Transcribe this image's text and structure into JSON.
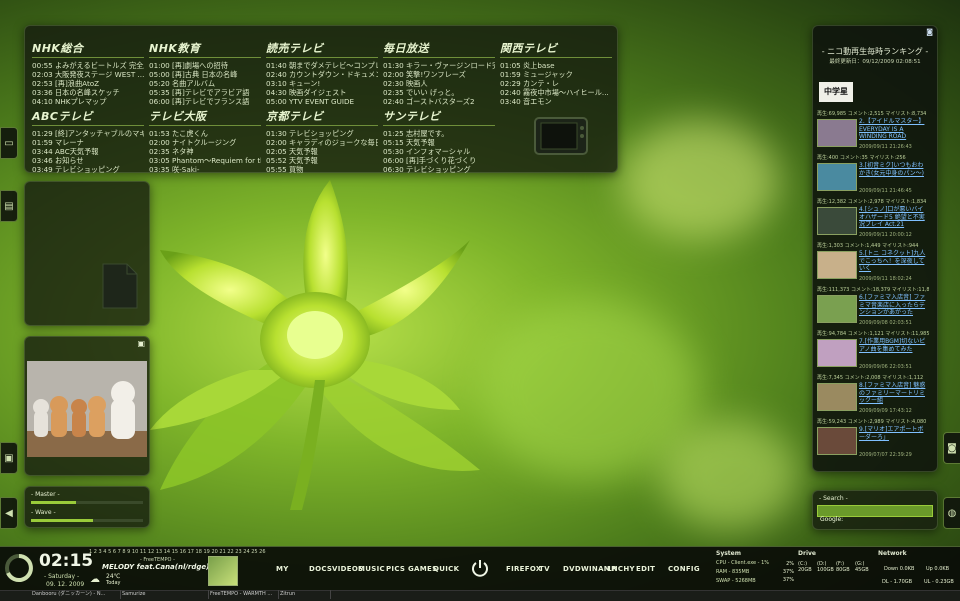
{
  "tv_guide": {
    "channels": [
      {
        "name": "NHK総合",
        "rows": [
          "00:55 よみがえるビートルズ 完全版",
          "02:03 大阪発夜ステージ WEST ...",
          "02:53 [再]浪曲AtoZ",
          "03:36 日本の名峰スケッチ",
          "04:10 NHKプレマップ"
        ]
      },
      {
        "name": "NHK教育",
        "rows": [
          "01:00 [再]劇場への招待",
          "05:00 [再]古典 日本の名峰",
          "05:20 名曲アルバム",
          "05:35 [再]テレビでアラビア語",
          "06:00 [再]テレビでフランス語"
        ]
      },
      {
        "name": "読売テレビ",
        "rows": [
          "01:40 朝までダメテレビ～コンプレッ...",
          "02:40 カウントダウン・ドキュメント ...",
          "03:10 キューン!",
          "04:30 映画ダイジェスト",
          "05:00 YTV EVENT GUIDE"
        ]
      },
      {
        "name": "毎日放送",
        "rows": [
          "01:30 キラー・ヴァージンロード完全...",
          "02:00 笑撃!ワンフレーズ",
          "02:30 映画人",
          "02:35 でいい げっと。",
          "02:40 ゴーストバスターズ2"
        ]
      },
      {
        "name": "関西テレビ",
        "rows": [
          "01:05 炎上base",
          "01:59 ミュージャック",
          "02:29 カンテ・レ",
          "02:40 霧夜中市場～ハイヒール...",
          "03:40 音エモン"
        ]
      },
      {
        "name": "ABCテレビ",
        "rows": [
          "01:29 [終]アンタッチャブルのマキマ...",
          "01:59 マレーナ",
          "03:44 ABC天気予報",
          "03:46 お知らせ",
          "03:49 テレビショッピング"
        ]
      },
      {
        "name": "テレビ大阪",
        "rows": [
          "01:53 たこ虎くん",
          "02:00 ナイトクルージング",
          "02:35 ネタ神",
          "03:05 Phantom～Requiem for the ...",
          "03:35 咲-Saki-"
        ]
      },
      {
        "name": "京都テレビ",
        "rows": [
          "01:30 テレビショッピング",
          "02:00 キャラディのジョークな毎日",
          "02:05 天気予報",
          "05:52 天気予報",
          "05:55 買物"
        ]
      },
      {
        "name": "サンテレビ",
        "rows": [
          "01:25 志村屋です。",
          "05:15 天気予報",
          "05:30 インフォマーシャル",
          "06:00 [再]手づくり花づくり",
          "06:30 テレビショッピング"
        ]
      }
    ]
  },
  "ranking": {
    "title": "- ニコ動再生毎時ランキング -",
    "updated": "最終更新日：09/12/2009 02:08:51",
    "top_banner": "中学星",
    "items": [
      {
        "meta": "再生:69,985 コメント:2,515 マイリスト:8,734",
        "title": "2.【アイドルマスター】EVERYDAY IS A WINDING ROAD",
        "date": "2009/09/11 21:26:43",
        "thumb": "#8a7a90"
      },
      {
        "meta": "再生:400 コメント:35 マイリスト:256",
        "title": "3.[初音ミク]いつもおわかき(女元中身のパン～)",
        "date": "2009/09/11 21:46:45",
        "thumb": "#4a8aa0"
      },
      {
        "meta": "再生:12,382 コメント:2,978 マイリスト:1,834",
        "title": "4.[シュノ]口が悪いバイオハザード5 絶望と不実況プレイ Act.21",
        "date": "2009/09/11 20:00:12",
        "thumb": "#3a4a3a"
      },
      {
        "meta": "再生:1,303 コメント:1,449 マイリスト:944",
        "title": "5.[トニ コネクット]九人でこっちへ！を深夜していく",
        "date": "2009/09/11 18:02:24",
        "thumb": "#c8b08a"
      },
      {
        "meta": "再生:111,373 コメント:18,379 マイリスト:11,815",
        "title": "6.[ファミマ入店音] ファミマ音楽店に入ったらテンションがあがった",
        "date": "2009/09/08 02:03:51",
        "thumb": "#7aa050"
      },
      {
        "meta": "再生:94,784 コメント:1,121 マイリスト:11,985",
        "title": "7.[作業用BGM]切ないピアノ曲を集めてみた",
        "date": "2009/09/06 22:03:51",
        "thumb": "#c0a0c0"
      },
      {
        "meta": "再生:7,345 コメント:2,008 マイリスト:1,112",
        "title": "8.[ファミマ入店音] 魅惑のファミリーマートリミックー組",
        "date": "2009/09/09 17:43:12",
        "thumb": "#9a8a60"
      },
      {
        "meta": "再生:59,243 コメント:2,989 マイリスト:4,080",
        "title": "9.[マリオ]エアポートボーダーろ」",
        "date": "2009/07/07 22:39:29",
        "thumb": "#6a4a3a"
      }
    ]
  },
  "search": {
    "label": "- Search -",
    "engine": "Google:"
  },
  "volume": {
    "master_label": "- Master -",
    "wave_label": "- Wave -",
    "master_level": 0.4,
    "wave_level": 0.55
  },
  "clock": {
    "time": "02:15",
    "day": "- Saturday -",
    "date": "09. 12. 2009",
    "calendar": "1 2 3 4 5 6 7 8 9 10 11 12 13 14 15 16 17 18 19 20 21 22 23 24 25 26"
  },
  "weather": {
    "temp": "24℃",
    "today": "Today"
  },
  "music": {
    "source": "- FreeTEMPO -",
    "track": "MELODY feat.Cana(nl/rdge)"
  },
  "menu": [
    "MY",
    "DOCS",
    "VIDEOS",
    "MUSIC",
    "PICS",
    "GAMES",
    "QUICK",
    "FIREFOX",
    "TV",
    "DVD",
    "WINAMP",
    "LNCHY",
    "EDIT",
    "CONFIG"
  ],
  "system": {
    "title": "System",
    "cpu": "CPU - Client.exe - 1%",
    "ram": "RAM - 835MB",
    "swap": "SWAP - 5268MB",
    "cpu_pct": "2%",
    "ram_pct": "37%",
    "swap_pct": "37%",
    "cpu_level": 0.02,
    "ram_level": 0.37,
    "swap_level": 0.37
  },
  "drive": {
    "title": "Drive",
    "drives": [
      {
        "letter": "(C:)",
        "size": "20GB"
      },
      {
        "letter": "(D:)",
        "size": "100GB"
      },
      {
        "letter": "(F:)",
        "size": "80GB"
      },
      {
        "letter": "(G:)",
        "size": "45GB"
      }
    ]
  },
  "network": {
    "title": "Network",
    "down": "Down 0.0KB",
    "up": "Up 0.0KB",
    "dl": "DL - 1.70GB",
    "ul": "UL - 0.23GB"
  },
  "taskbar": [
    "Danbooru (ダニッカーン) - N...",
    "Samurize",
    "FreeTEMPO - WARMTH ...",
    "Zitrun"
  ],
  "colors": {
    "accent": "#9acb3a",
    "panel": "#141a10",
    "link": "#7fc0ff"
  }
}
